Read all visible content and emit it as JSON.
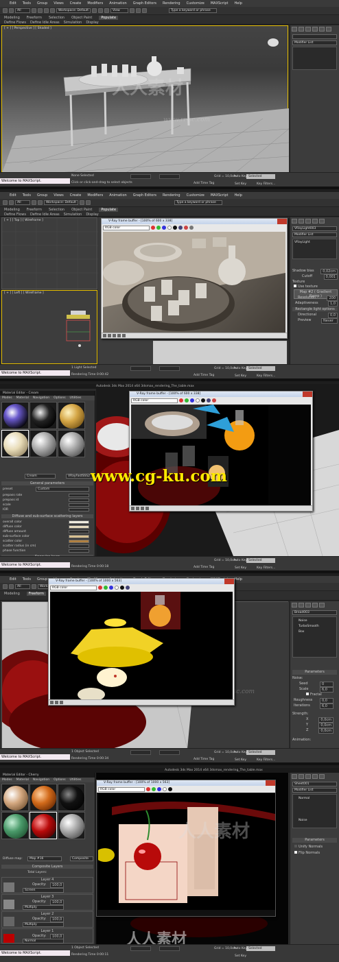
{
  "menu": [
    "Edit",
    "Tools",
    "Group",
    "Views",
    "Create",
    "Modifiers",
    "Animation",
    "Graph Editors",
    "Rendering",
    "Customize",
    "MAXScript",
    "Help"
  ],
  "workspace": "Workspace: Default",
  "selection_filter": "All",
  "search_placeholder": "Type a keyword or phrase",
  "ribbon_tabs": [
    "Modeling",
    "Freeform",
    "Selection",
    "Object Paint",
    "Populate"
  ],
  "ribbon_sub": [
    "Define Flows",
    "Define Idle Areas",
    "Simulation",
    "Display"
  ],
  "listener": "Welcome to MAXScript.",
  "add_time_tag": "Add Time Tag",
  "key_filters": "Key Filters...",
  "set_key": "Set Key",
  "auto_key": "Auto Key",
  "selected": "Selected",
  "grid": "Grid = 10,0cm",
  "app_title": "Autodesk 3ds Max 2014 x64",
  "panels": [
    {
      "viewport_label": "[ + ] [ Perspective ] [ Shaded ]",
      "status_sel": "None Selected",
      "status_hint": "Click or click-and-drag to select objects",
      "modifier": "Modifier List",
      "object": ""
    },
    {
      "viewport_label": "[ + ] [ Top ] [ Wireframe ]",
      "viewport_label2": "[ + ] [ Left ] [ Wireframe ]",
      "status_sel": "1 Light Selected",
      "status_hint": "Rendering Time 0:00:42",
      "modifier": "Modifier List",
      "object": "VRayLight003",
      "object_item": "VRayLight",
      "vfb_title": "V-Ray frame buffer - [100% of 600 x 338]",
      "channel": "RGB color",
      "params": [
        "Shadow bias",
        "Cutoff",
        "Texture",
        "Use texture",
        "Map #2 ( Gradient Ramp )",
        "Resolution",
        "Adaptiveness",
        "Rectangle light options",
        "Directional",
        "Preview"
      ],
      "param_vals": [
        "0,02cm",
        "0,001",
        "",
        "",
        "",
        "200",
        "1,0",
        "",
        "0,0",
        "Never"
      ]
    },
    {
      "status_sel": "",
      "status_hint": "Rendering Time 0:00:18",
      "vfb_title": "V-Ray frame buffer - [100% of 600 x 338]",
      "window_title": "Autodesk 3ds Max 2014 x64    3dsmax_rendering_The_table.max",
      "channel": "RGB color",
      "me_title": "Material Editor - Cream",
      "me_menu": [
        "Modes",
        "Material",
        "Navigation",
        "Options",
        "Utilities"
      ],
      "material_name": "Cream",
      "material_type": "VRayFastSSS2",
      "rollout": "General parameters",
      "preset_label": "preset",
      "preset_val": "Custom",
      "rows": [
        "prepass rate",
        "prepass id",
        "scale",
        "IOR"
      ],
      "rollout2": "Diffuse and sub-surface scattering layers",
      "rows2": [
        "overall color",
        "diffuse color",
        "diffuse amount",
        "sub-surface color",
        "scatter color",
        "scatter radius (in cm)",
        "phase function"
      ],
      "rollout3": "Specular layer"
    },
    {
      "status_sel": "1 Object Selected",
      "status_hint": "Rendering Time 0:00:34",
      "vfb_title": "V-Ray frame buffer - [100% of 1000 x 563]",
      "channel": "RGB color",
      "object": "Bread003",
      "stack": [
        "Noise",
        "TurboSmooth",
        "Box"
      ],
      "params_title": "Parameters",
      "noise_label": "Noise:",
      "noise_rows": [
        "Seed",
        "Scale",
        "Fractal",
        "Roughness",
        "Iterations"
      ],
      "noise_vals": [
        "0",
        "6,0",
        "",
        "0,0",
        "6,0"
      ],
      "strength": "Strength:",
      "xyz": [
        "X",
        "Y",
        "Z"
      ],
      "xyz_vals": [
        "0,0cm",
        "0,0cm",
        "0,0cm"
      ],
      "animation": "Animation:"
    },
    {
      "status_sel": "1 Object Selected",
      "status_hint": "Rendering Time 0:00:11",
      "vfb_title": "V-Ray frame buffer - [100% of 1000 x 563]",
      "window_title": "Autodesk 3ds Max 2014 x64    3dsmax_rendering_The_table.max",
      "channel": "RGB color",
      "me_title": "Material Editor - Cherry",
      "me_menu": [
        "Modes",
        "Material",
        "Navigation",
        "Options",
        "Utilities"
      ],
      "diffuse_label": "Diffuse map:",
      "map_name": "Map #16",
      "map_type": "Composite",
      "composite_rollout": "Composite Layers",
      "total_layers": "Total Layers:",
      "layers": [
        "Layer 4",
        "Layer 3",
        "Layer 2",
        "Layer 1"
      ],
      "opacity_label": "Opacity:",
      "opacity_vals": [
        "100,0",
        "100,0",
        "100,0",
        "100,0"
      ],
      "blend_modes": [
        "Screen",
        "Multiply",
        "Multiply",
        "Normal"
      ],
      "object": "Sheet001",
      "stack": [
        "Normal",
        "Noise"
      ],
      "params_title": "Parameters",
      "params": [
        "Unify Normals",
        "Flip Normals"
      ]
    }
  ],
  "watermarks": [
    "人人素材",
    "www.rr-sc.com"
  ],
  "cgku": "www.cg-ku.com"
}
